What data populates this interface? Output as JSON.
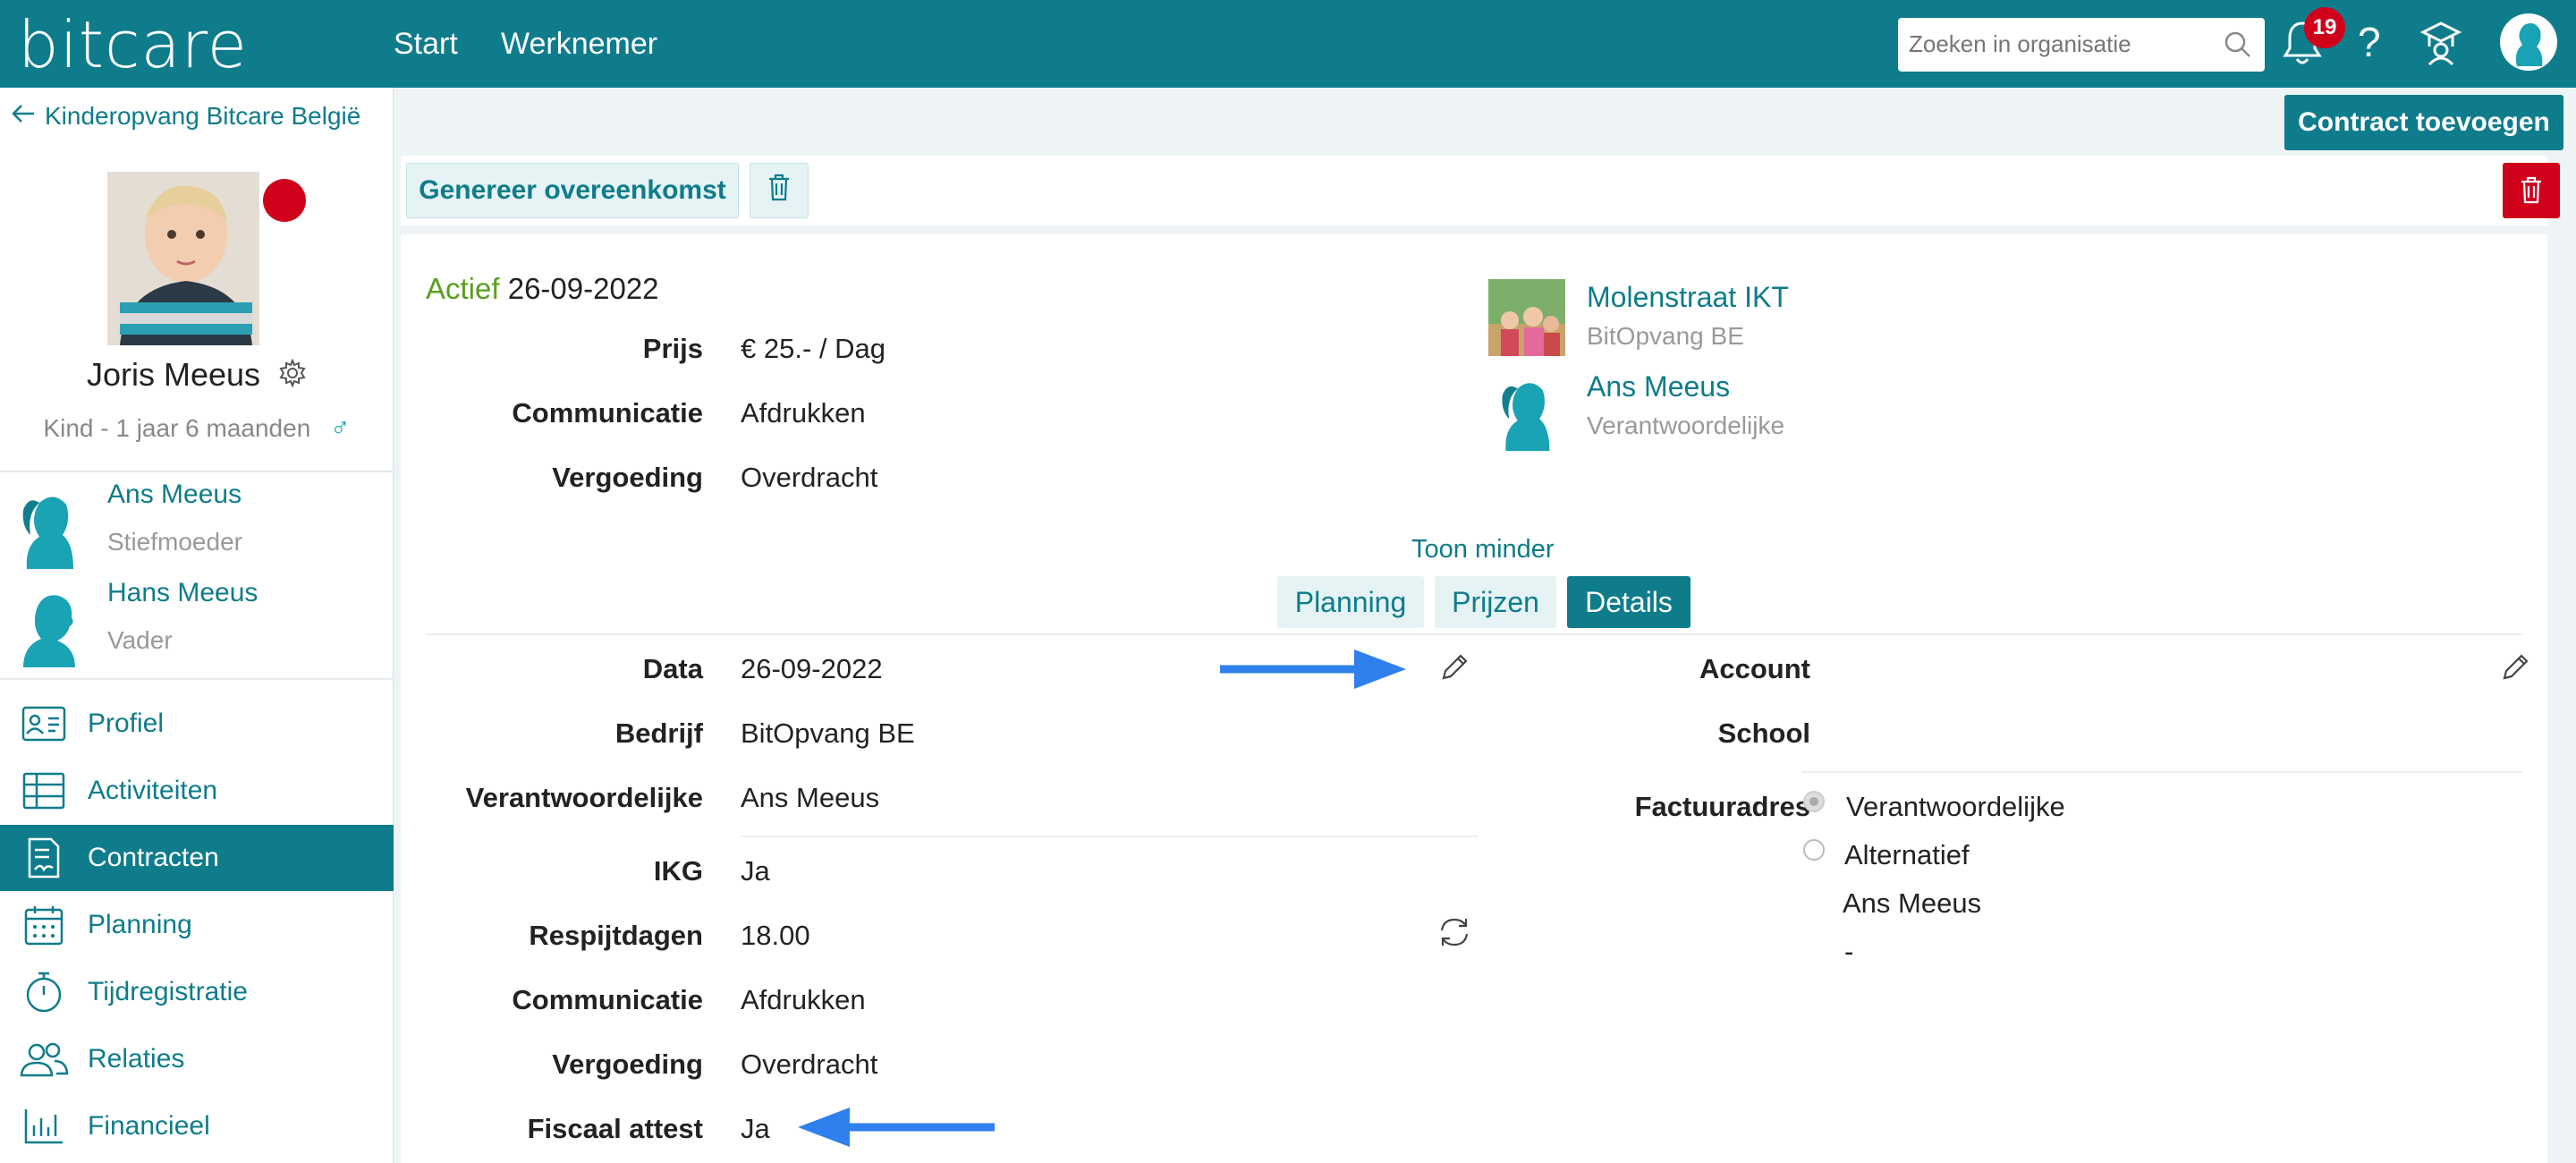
{
  "header": {
    "logo": "bitcare",
    "nav": [
      "Start",
      "Werknemer"
    ],
    "search_placeholder": "Zoeken in organisatie",
    "notification_count": "19",
    "help": "?"
  },
  "sidebar": {
    "back_label": "Kinderopvang Bitcare België",
    "child_name": "Joris Meeus",
    "child_sub": "Kind - 1 jaar 6 maanden",
    "gender_symbol": "♂",
    "relations": [
      {
        "name": "Ans Meeus",
        "role": "Stiefmoeder"
      },
      {
        "name": "Hans Meeus",
        "role": "Vader"
      }
    ],
    "menu": [
      {
        "label": "Profiel",
        "icon": "id-card-icon"
      },
      {
        "label": "Activiteiten",
        "icon": "table-icon"
      },
      {
        "label": "Contracten",
        "icon": "contract-icon",
        "active": true
      },
      {
        "label": "Planning",
        "icon": "calendar-icon"
      },
      {
        "label": "Tijdregistratie",
        "icon": "stopwatch-icon"
      },
      {
        "label": "Relaties",
        "icon": "people-icon"
      },
      {
        "label": "Financieel",
        "icon": "bar-chart-icon"
      }
    ]
  },
  "actions": {
    "add_contract": "Contract toevoegen",
    "generate_agreement": "Genereer overeenkomst"
  },
  "contract": {
    "status": "Actief",
    "start_date": "26-09-2022",
    "summary": [
      {
        "label": "Prijs",
        "value": "€ 25.- / Dag"
      },
      {
        "label": "Communicatie",
        "value": "Afdrukken"
      },
      {
        "label": "Vergoeding",
        "value": "Overdracht"
      }
    ],
    "location": {
      "name": "Molenstraat IKT",
      "sub": "BitOpvang BE"
    },
    "responsible": {
      "name": "Ans Meeus",
      "sub": "Verantwoordelijke"
    },
    "toggle_label": "Toon minder",
    "tabs": [
      "Planning",
      "Prijzen",
      "Details"
    ],
    "active_tab": "Details",
    "details": [
      {
        "label": "Data",
        "value": "26-09-2022"
      },
      {
        "label": "Bedrijf",
        "value": "BitOpvang BE"
      },
      {
        "label": "Verantwoordelijke",
        "value": "Ans Meeus"
      },
      {
        "label": "IKG",
        "value": "Ja"
      },
      {
        "label": "Respijtdagen",
        "value": "18.00"
      },
      {
        "label": "Communicatie",
        "value": "Afdrukken"
      },
      {
        "label": "Vergoeding",
        "value": "Overdracht"
      },
      {
        "label": "Fiscaal attest",
        "value": "Ja"
      }
    ],
    "right": {
      "account_label": "Account",
      "school_label": "School",
      "invoice_label": "Factuuradres",
      "invoice_options": [
        "Verantwoordelijke",
        "Alternatief"
      ],
      "invoice_name": "Ans Meeus",
      "invoice_extra": "-"
    }
  },
  "colors": {
    "brand": "#0f7c8c",
    "danger": "#d0021b",
    "active_status": "#5a9e1e",
    "arrow": "#2f80ed"
  }
}
